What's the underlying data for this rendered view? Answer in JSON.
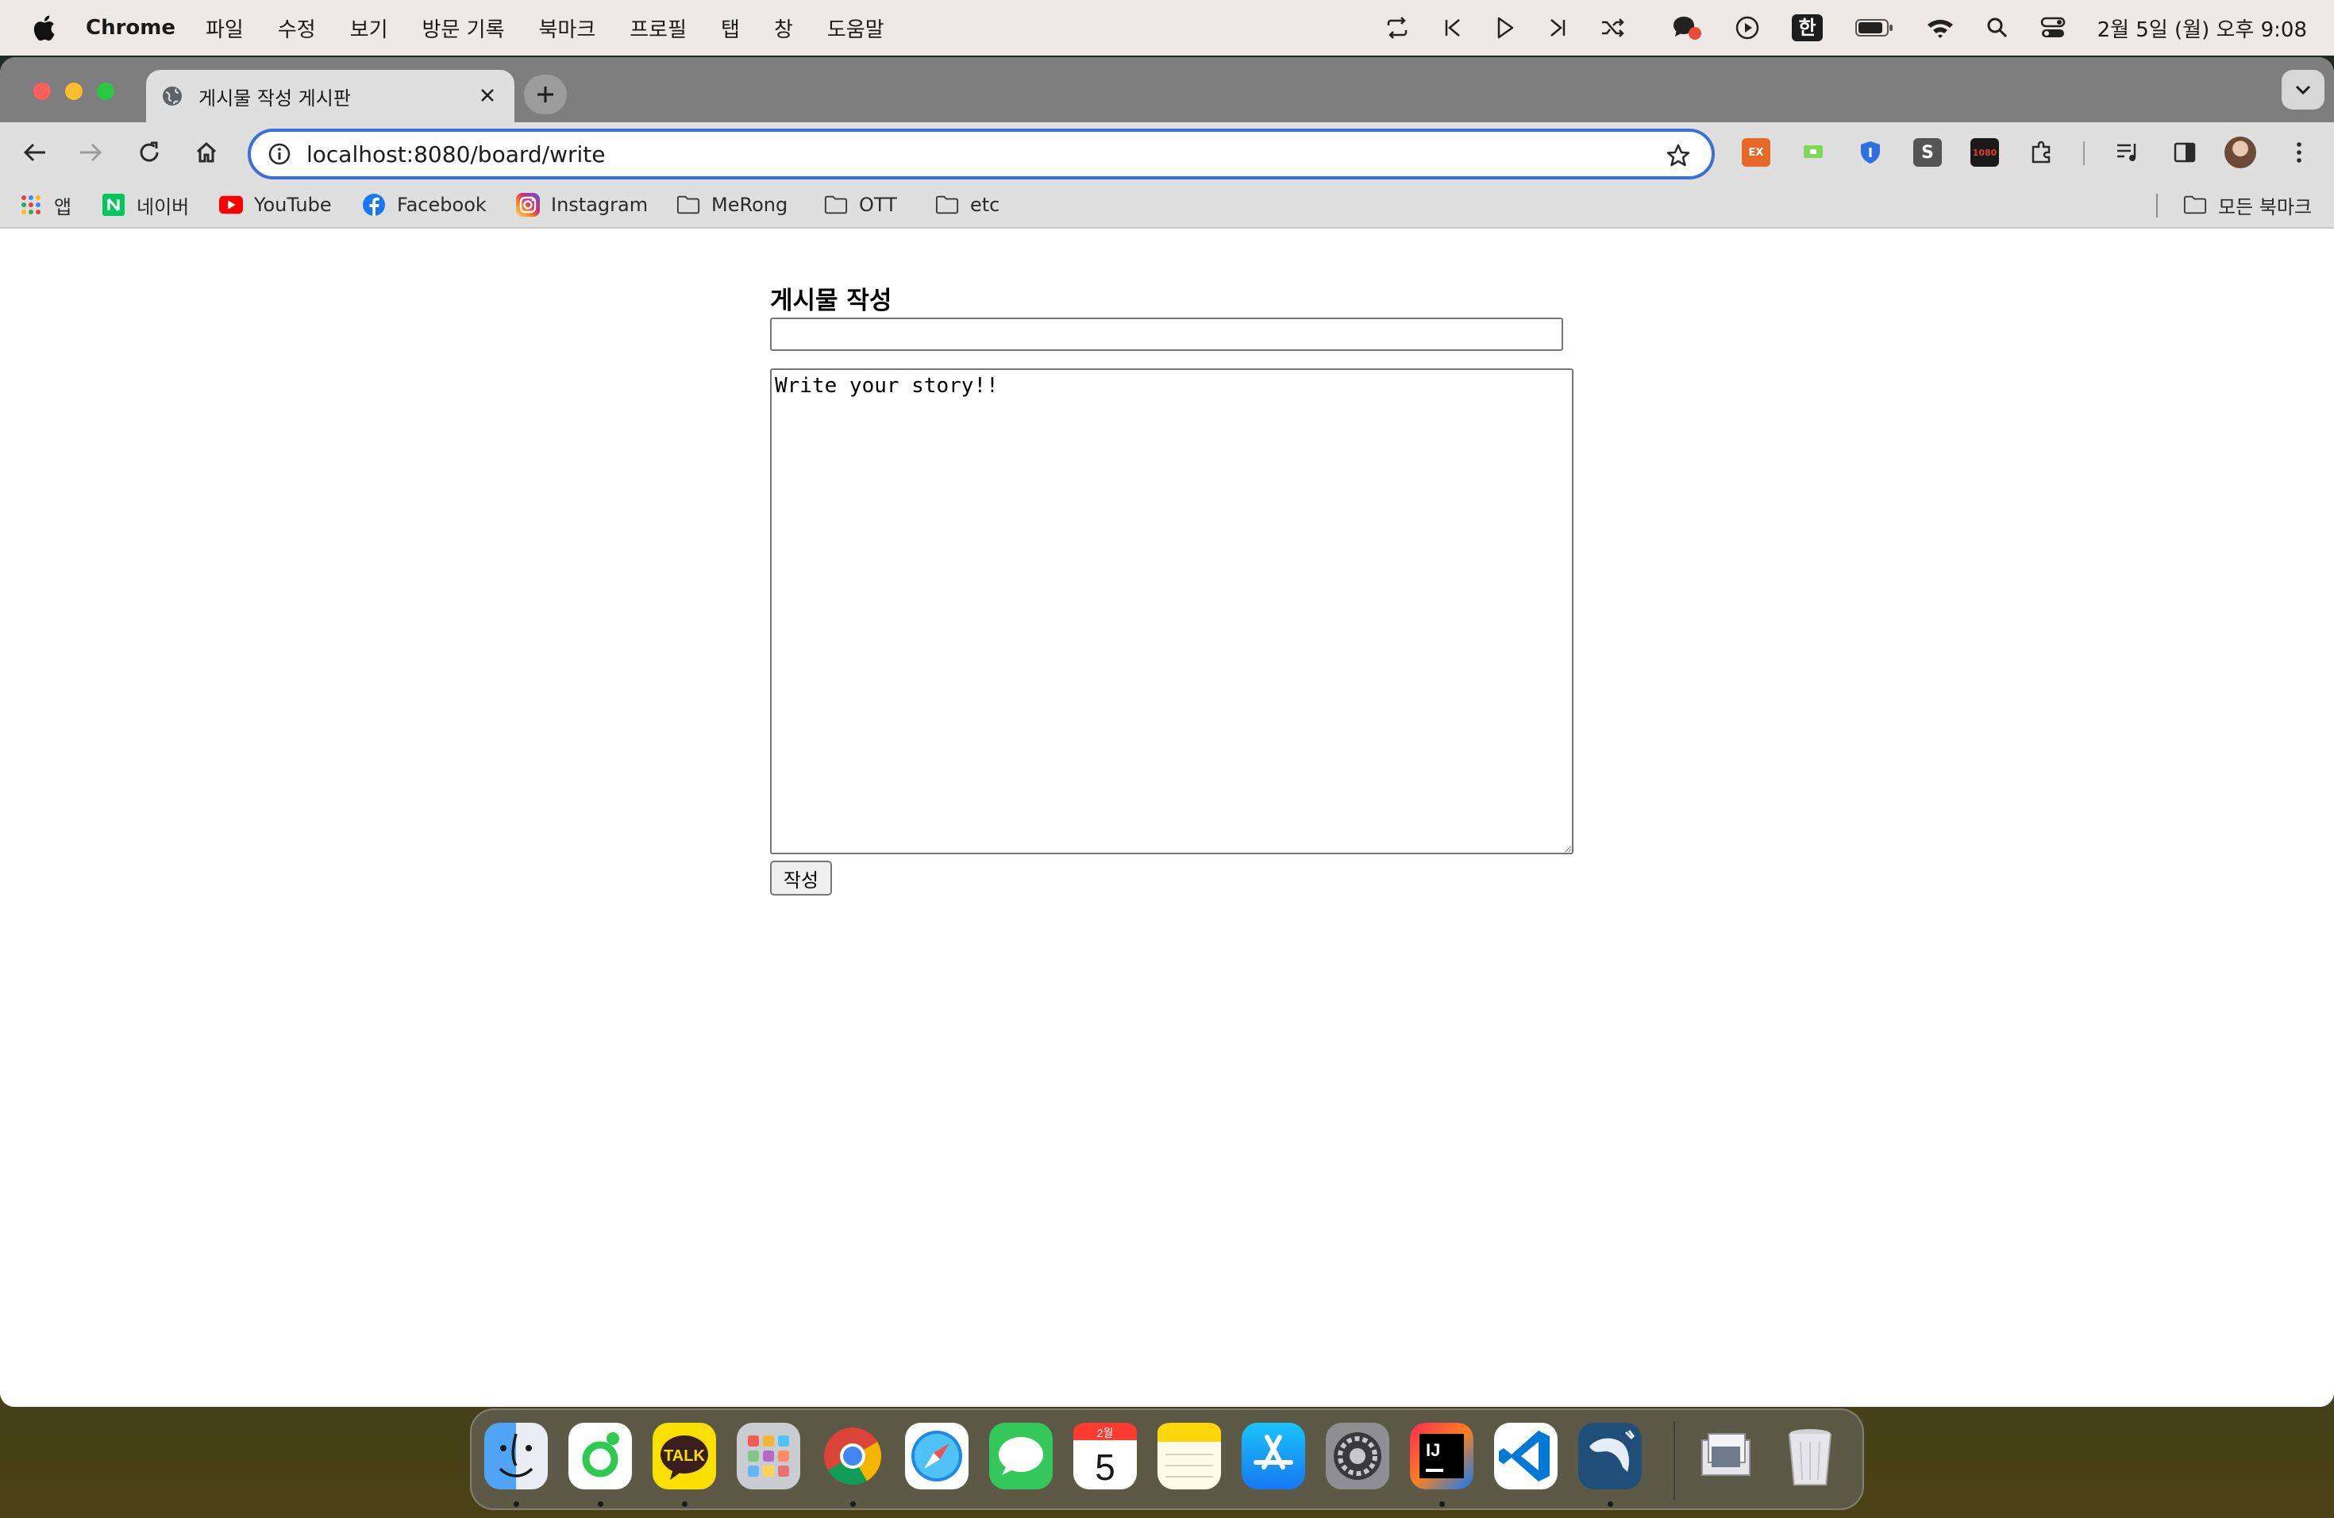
{
  "menubar": {
    "app_name": "Chrome",
    "items": [
      "파일",
      "수정",
      "보기",
      "방문 기록",
      "북마크",
      "프로필",
      "탭",
      "창",
      "도움말"
    ],
    "input_source": "한",
    "clock": "2월 5일 (월) 오후 9:08"
  },
  "tab": {
    "title": "게시물 작성 게시판"
  },
  "omnibox": {
    "url": "localhost:8080/board/write"
  },
  "extensions": [
    "EX",
    "S",
    "1080"
  ],
  "bookmarks": {
    "apps_label": "앱",
    "items": [
      "네이버",
      "YouTube",
      "Facebook",
      "Instagram",
      "MeRong",
      "OTT",
      "etc"
    ],
    "all_bookmarks": "모든 북마크"
  },
  "form": {
    "heading": "게시물 작성",
    "title_value": "",
    "body_value": "Write your story!!",
    "submit_label": "작성"
  },
  "dock": {
    "calendar_month": "2월",
    "calendar_day": "5",
    "kakao_label": "TALK",
    "intellij_label": "IJ"
  },
  "colors": {
    "omnibox_focus": "#3a6fd8",
    "close": "#fe5f57",
    "minimize": "#febc2e",
    "maximize": "#28c840"
  }
}
